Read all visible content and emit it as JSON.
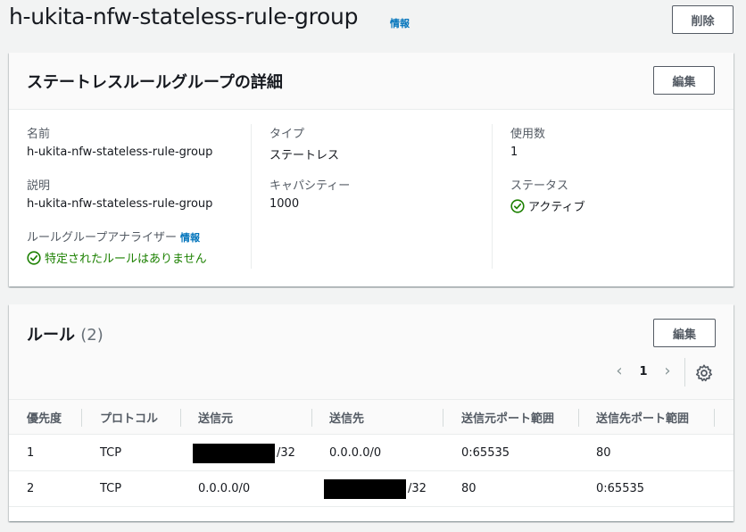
{
  "header": {
    "title": "h-ukita-nfw-stateless-rule-group",
    "info": "情報",
    "delete_label": "削除"
  },
  "details": {
    "title": "ステートレスルールグループの詳細",
    "edit_label": "編集",
    "name_label": "名前",
    "name_value": "h-ukita-nfw-stateless-rule-group",
    "description_label": "説明",
    "description_value": "h-ukita-nfw-stateless-rule-group",
    "analyzer_label": "ルールグループアナライザー",
    "analyzer_info": "情報",
    "analyzer_status": "特定されたルールはありません",
    "type_label": "タイプ",
    "type_value": "ステートレス",
    "capacity_label": "キャパシティー",
    "capacity_value": "1000",
    "usage_label": "使用数",
    "usage_value": "1",
    "status_label": "ステータス",
    "status_value": "アクティブ"
  },
  "rules": {
    "title": "ルール",
    "count": "(2)",
    "edit_label": "編集",
    "page": "1",
    "columns": [
      "優先度",
      "プロトコル",
      "送信元",
      "送信先",
      "送信元ポート範囲",
      "送信先ポート範囲"
    ],
    "rows": [
      {
        "priority": "1",
        "protocol": "TCP",
        "source": "/32",
        "source_redacted": true,
        "destination": "0.0.0.0/0",
        "destination_redacted": false,
        "src_ports": "0:65535",
        "dst_ports": "80"
      },
      {
        "priority": "2",
        "protocol": "TCP",
        "source": "0.0.0.0/0",
        "source_redacted": false,
        "destination": "/32",
        "destination_redacted": true,
        "src_ports": "80",
        "dst_ports": "0:65535"
      }
    ]
  },
  "colors": {
    "link": "#0073bb",
    "success": "#1d8102",
    "text": "#16191f",
    "muted": "#545b64"
  },
  "icons": [
    "status-positive-icon",
    "chevron-left-icon",
    "chevron-right-icon",
    "gear-icon"
  ]
}
